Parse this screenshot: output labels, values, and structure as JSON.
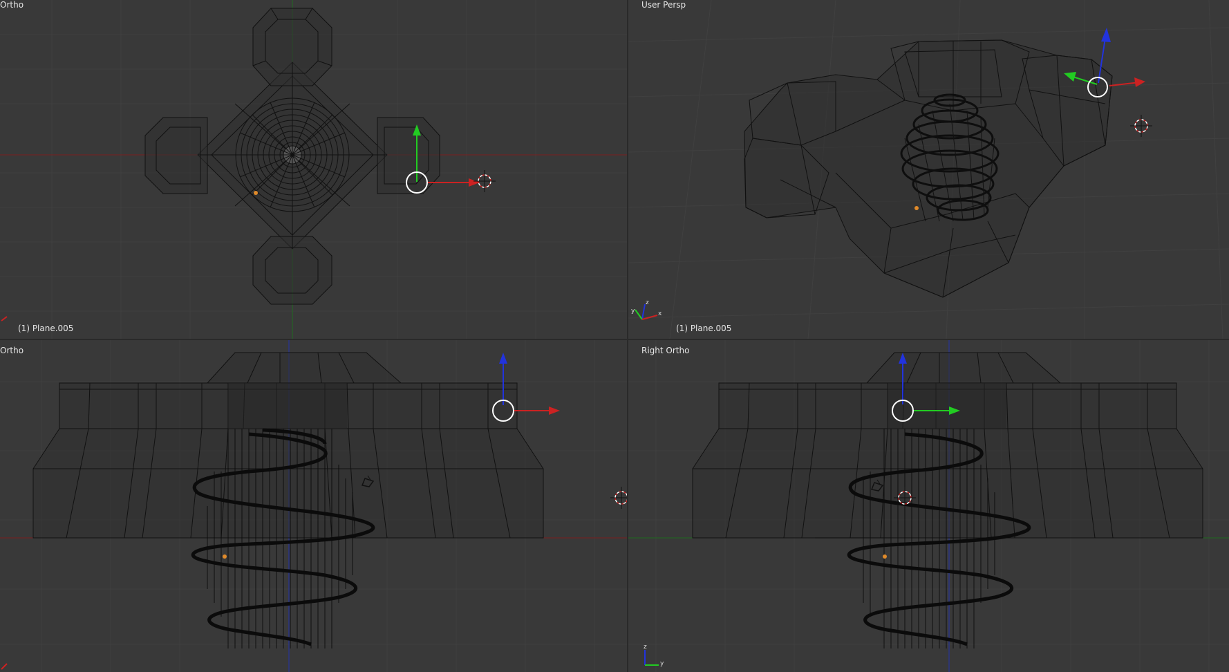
{
  "viewports": {
    "top_left": {
      "title": "Ortho",
      "object": "(1) Plane.005"
    },
    "top_right": {
      "title": "User Persp",
      "object": "(1) Plane.005"
    },
    "bottom_left": {
      "title": "Ortho"
    },
    "bottom_right": {
      "title": "Right Ortho"
    }
  },
  "axis_labels": {
    "x": "x",
    "y": "y",
    "z": "z"
  },
  "colors": {
    "background": "#393939",
    "grid": "#404040",
    "axis_x": "#cc2222",
    "axis_y": "#22cc22",
    "axis_z": "#2233dd",
    "wire": "#111111",
    "origin": "#e08a2a"
  }
}
